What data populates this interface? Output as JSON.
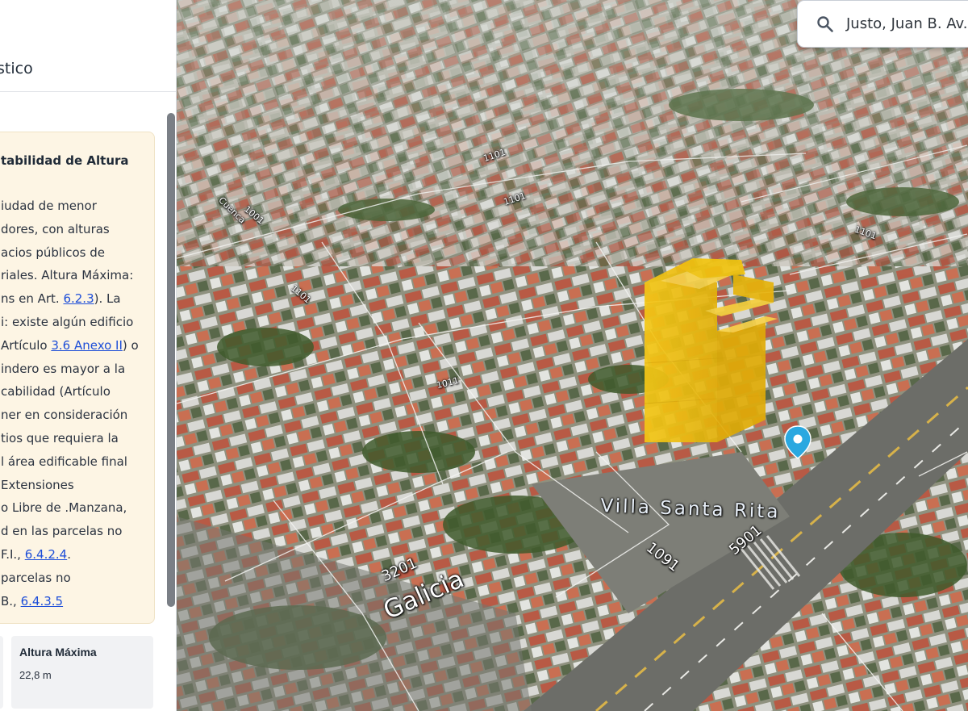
{
  "panel": {
    "title": "stico",
    "notice": {
      "title": "tabilidad de Altura",
      "lines": [
        {
          "pre": "iudad de menor"
        },
        {
          "pre": "dores, con alturas"
        },
        {
          "pre": "acios públicos de"
        },
        {
          "pre": "riales. Altura Máxima:"
        },
        {
          "pre": "ns en Art. ",
          "link": "6.2.3",
          "post": "). La"
        },
        {
          "pre": "i: existe algún edificio"
        },
        {
          "pre": "Artículo ",
          "link": "3.6 Anexo II",
          "post": ") o"
        },
        {
          "pre": "indero es mayor a la"
        },
        {
          "pre": "cabilidad (Artículo"
        },
        {
          "pre": "ner en consideración"
        },
        {
          "pre": "tios que requiera la"
        },
        {
          "pre": "l área edificable final"
        },
        {
          "pre": "Extensiones"
        },
        {
          "pre": "o Libre de .Manzana,"
        },
        {
          "pre": "d en las parcelas no"
        },
        {
          "pre": "F.I., ",
          "link": "6.4.2.4",
          "post": "."
        },
        {
          "pre": "parcelas no"
        },
        {
          "pre": "B., ",
          "link": "6.4.3.5",
          "post": ""
        }
      ]
    },
    "stat": {
      "label": "Altura Máxima",
      "value": "22,8 m"
    }
  },
  "search": {
    "value": "Justo, Juan B. Av."
  },
  "map": {
    "labels": {
      "neighborhood": "Villa Santa Rita",
      "street_galicia": "Galicia",
      "num_3201": "3201",
      "num_5901": "5901",
      "num_1091": "1091",
      "num_1011": "1011",
      "num_1101a": "1101",
      "num_1101b": "1101",
      "num_1101c": "1101",
      "num_1101d": "1101",
      "street_cuenca": "Cuenca",
      "num_1001": "1001"
    },
    "colors": {
      "building": "#f2c40f",
      "pin": "#2aa8e0"
    }
  }
}
